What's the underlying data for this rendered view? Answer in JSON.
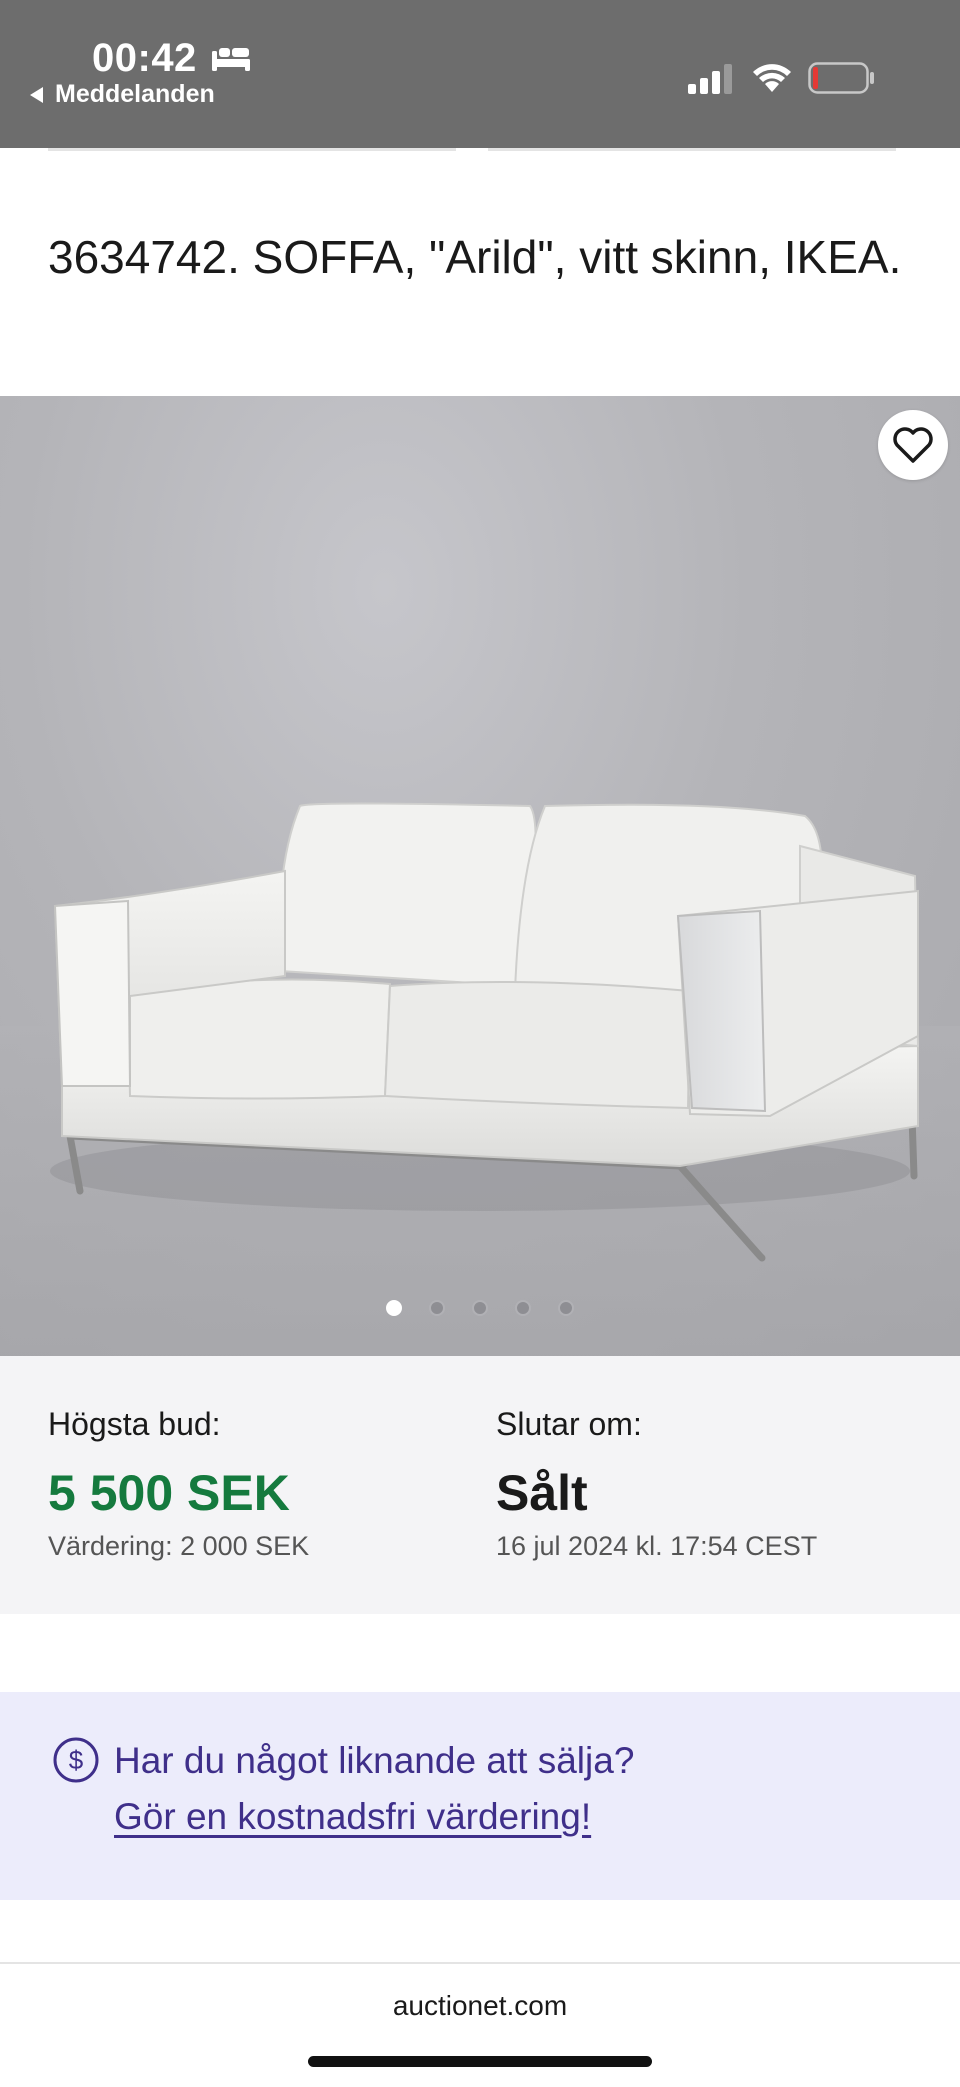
{
  "status_bar": {
    "time": "00:42",
    "back_label": "Meddelanden",
    "icons": [
      "bed-icon",
      "signal-icon",
      "wifi-icon",
      "battery-icon"
    ],
    "battery_color": "#e53935"
  },
  "listing": {
    "title": "3634742. SOFFA, \"Arild\", vitt skinn, IKEA.",
    "image_count": 5,
    "active_image_index": 0
  },
  "bid": {
    "highest_label": "Högsta bud:",
    "highest_value": "5 500 SEK",
    "valuation": "Värdering: 2 000 SEK",
    "ends_label": "Slutar om:",
    "ends_value": "Sålt",
    "ends_date": "16 jul 2024 kl. 17:54 CEST"
  },
  "sell_banner": {
    "question": "Har du något liknande att sälja?",
    "link": "Gör en kostnadsfri värdering!"
  },
  "footer": {
    "domain": "auctionet.com"
  },
  "colors": {
    "status_bar": "#6d6d6d",
    "bid_green": "#157a3e",
    "banner_bg": "#ececfb",
    "banner_text": "#3f2f8a"
  }
}
